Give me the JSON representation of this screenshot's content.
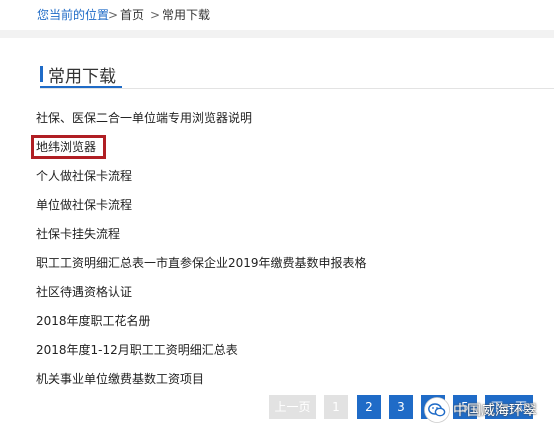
{
  "breadcrumb": {
    "location_label": "您当前的位置",
    "separator": ">",
    "home": "首页",
    "current": "常用下载"
  },
  "section": {
    "title": "常用下载"
  },
  "downloads": [
    "社保、医保二合一单位端专用浏览器说明",
    "地纬浏览器",
    "个人做社保卡流程",
    "单位做社保卡流程",
    "社保卡挂失流程",
    "职工工资明细汇总表一市直参保企业2019年缴费基数申报表格",
    "社区待遇资格认证",
    "2018年度职工花名册",
    "2018年度1-12月职工工资明细汇总表",
    "机关事业单位缴费基数工资项目"
  ],
  "pagination": {
    "prev_label": "上一页",
    "pages": [
      "1",
      "2",
      "3",
      "4",
      "5"
    ],
    "next_label": "下一页"
  },
  "watermark": {
    "text": "中国威海环翠",
    "icon": "wechat-icon"
  },
  "colors": {
    "accent": "#1f6bc7",
    "highlight": "#b01e23",
    "disabled": "#e2e2e2"
  }
}
